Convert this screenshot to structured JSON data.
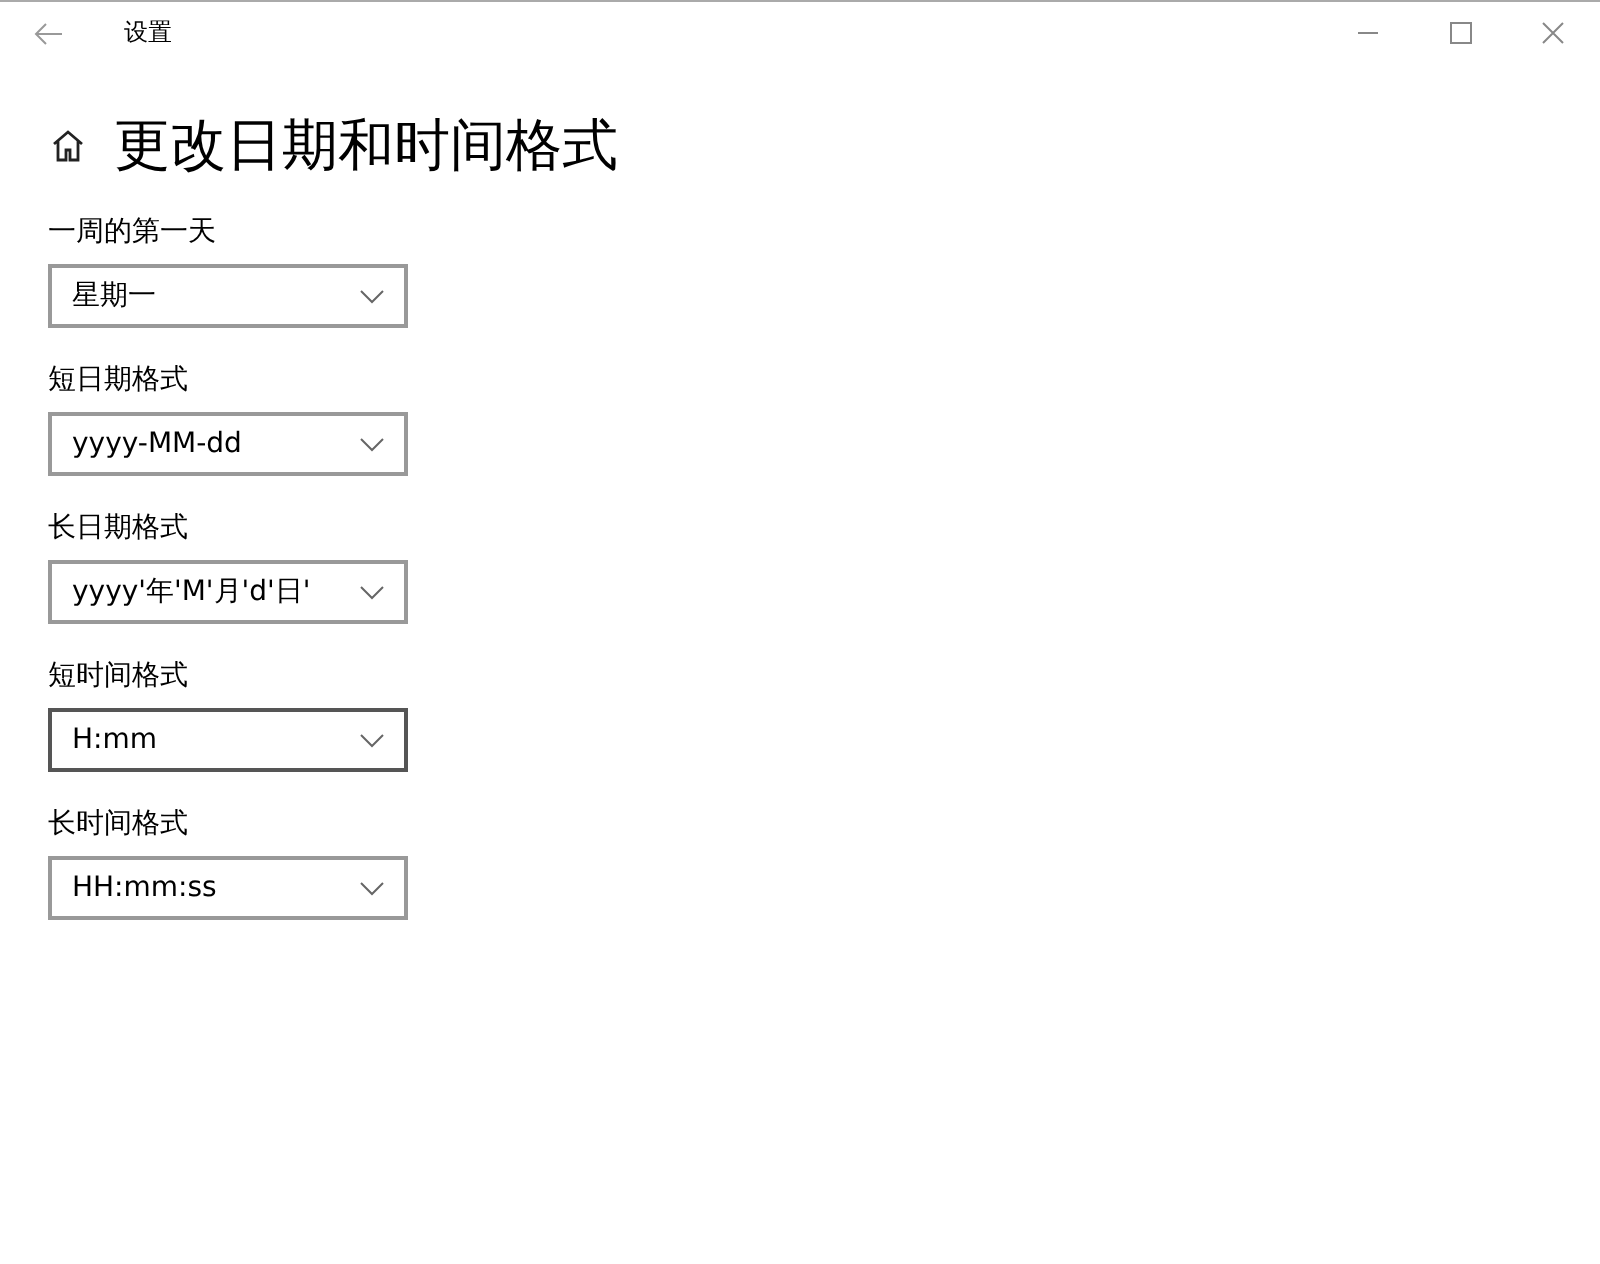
{
  "window": {
    "title": "设置"
  },
  "page": {
    "title": "更改日期和时间格式"
  },
  "settings": [
    {
      "label": "一周的第一天",
      "value": "星期一",
      "hovered": false
    },
    {
      "label": "短日期格式",
      "value": "yyyy-MM-dd",
      "hovered": false
    },
    {
      "label": "长日期格式",
      "value": "yyyy'年'M'月'd'日'",
      "hovered": false
    },
    {
      "label": "短时间格式",
      "value": "H:mm",
      "hovered": true
    },
    {
      "label": "长时间格式",
      "value": "HH:mm:ss",
      "hovered": false
    }
  ]
}
